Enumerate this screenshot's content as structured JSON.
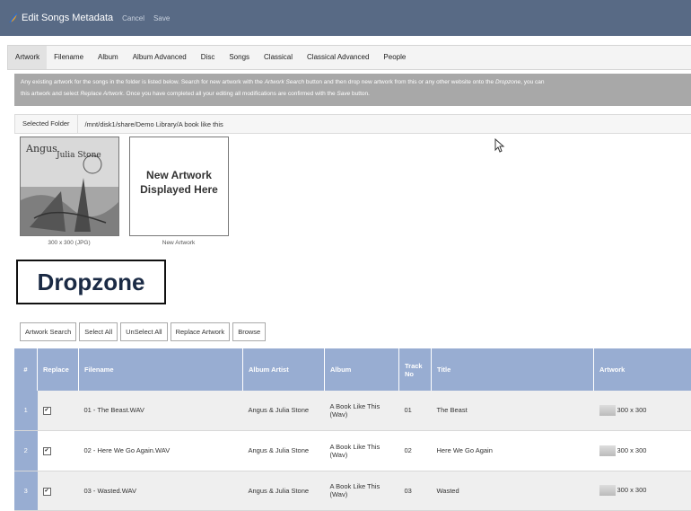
{
  "title": {
    "app_title": "Edit Songs Metadata",
    "cancel_label": "Cancel",
    "save_label": "Save"
  },
  "tabs": [
    "Artwork",
    "Filename",
    "Album",
    "Album Advanced",
    "Disc",
    "Songs",
    "Classical",
    "Classical Advanced",
    "People"
  ],
  "active_tab": "Artwork",
  "banner": {
    "line1_part1": "Any existing artwork for the songs in the folder is listed below. Search for new artwork with the ",
    "line1_em1": "Artwork Search",
    "line1_part2": " button and then drop new artwork from this or any other website onto the ",
    "line1_em2": "Dropzone",
    "line1_part3": ", you can",
    "line2_part1": "this artwork and select ",
    "line2_em1": "Replace Artwork",
    "line2_part2": ". Once you have completed all your editing all modifications are confirmed with the ",
    "line2_em2": "Save",
    "line2_part3": " button."
  },
  "folder": {
    "label": "Selected Folder",
    "path": "/mnt/disk1/share/Demo Library/A book like this"
  },
  "artwork_cards": {
    "existing_caption": "300 x 300 (JPG)",
    "new_title": "New Artwork Displayed Here",
    "new_caption": "New Artwork"
  },
  "dropzone_label": "Dropzone",
  "buttons": [
    "Artwork Search",
    "Select All",
    "UnSelect All",
    "Replace Artwork",
    "Browse"
  ],
  "table": {
    "headers": {
      "num": "#",
      "replace": "Replace",
      "filename": "Filename",
      "album_artist": "Album Artist",
      "album": "Album",
      "track_no": "Track No",
      "title": "Title",
      "artwork": "Artwork"
    },
    "rows": [
      {
        "num": "1",
        "filename": "01 - The Beast.WAV",
        "album_artist": "Angus & Julia Stone",
        "album": "A Book Like This (Wav)",
        "track": "01",
        "title": "The Beast",
        "artwork": "300 x 300"
      },
      {
        "num": "2",
        "filename": "02 - Here We Go Again.WAV",
        "album_artist": "Angus & Julia Stone",
        "album": "A Book Like This (Wav)",
        "track": "02",
        "title": "Here We Go Again",
        "artwork": "300 x 300"
      },
      {
        "num": "3",
        "filename": "03 - Wasted.WAV",
        "album_artist": "Angus & Julia Stone",
        "album": "A Book Like This (Wav)",
        "track": "03",
        "title": "Wasted",
        "artwork": "300 x 300"
      }
    ]
  },
  "colors": {
    "titlebar": "#586a85",
    "table_header": "#98add2",
    "banner": "#a8a8a8"
  }
}
